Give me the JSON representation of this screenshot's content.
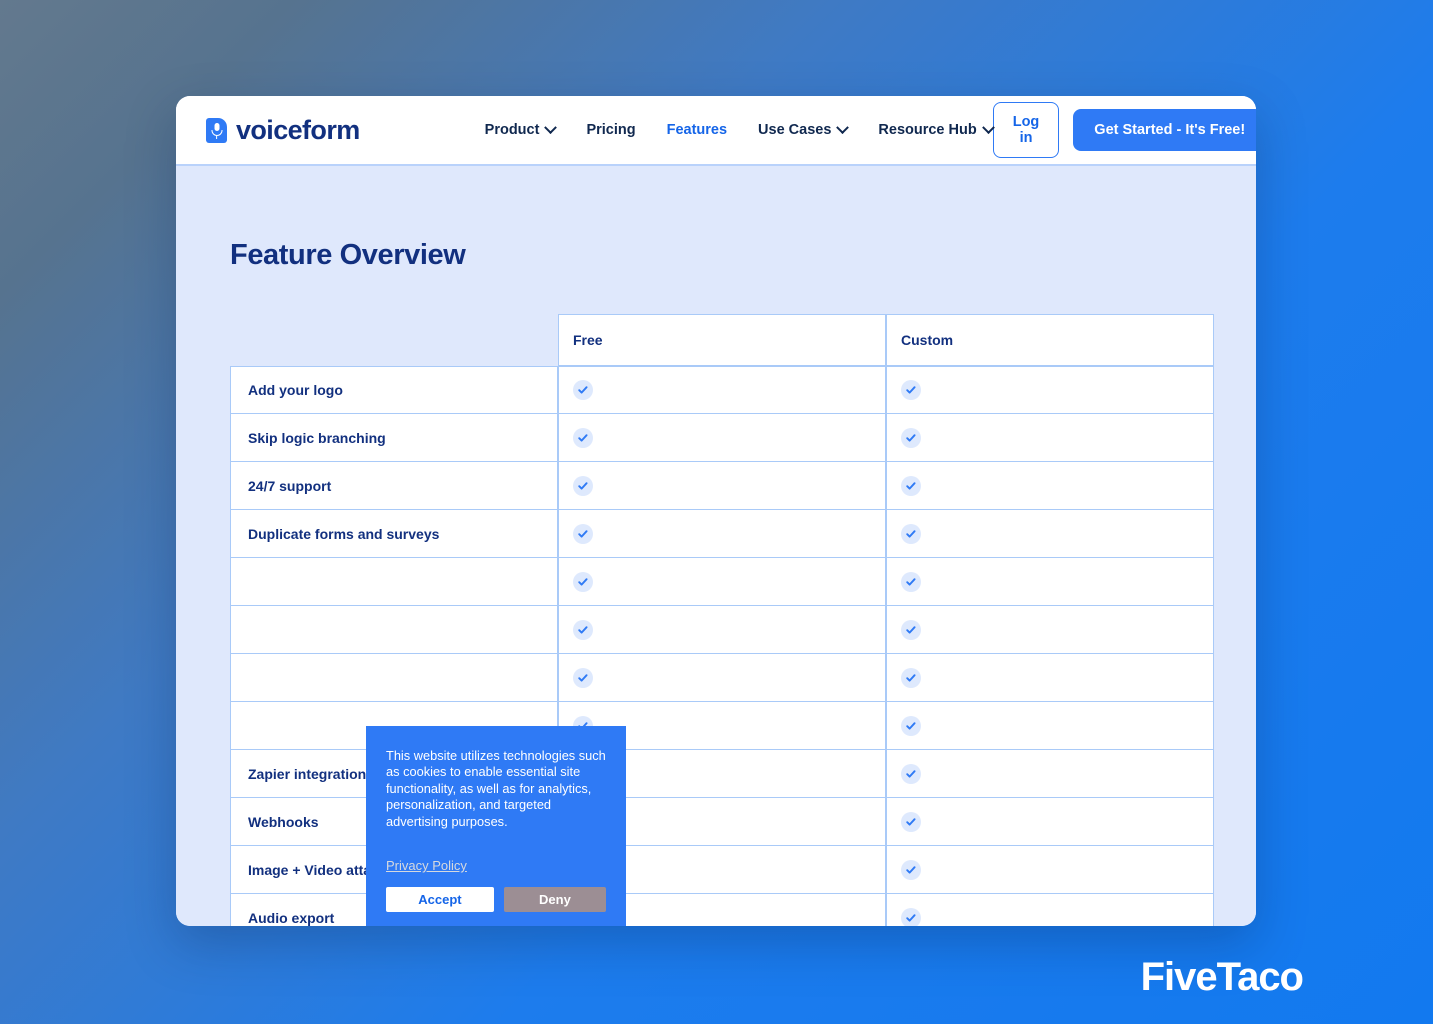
{
  "brand": {
    "logo_text": "voiceform",
    "logo_icon": "microphone-document-icon",
    "logo_color": "#2f7af5",
    "text_color": "#12307f"
  },
  "nav": {
    "links": [
      {
        "label": "Product",
        "has_dropdown": true,
        "active": false
      },
      {
        "label": "Pricing",
        "has_dropdown": false,
        "active": false
      },
      {
        "label": "Features",
        "has_dropdown": false,
        "active": true
      },
      {
        "label": "Use Cases",
        "has_dropdown": true,
        "active": false
      },
      {
        "label": "Resource Hub",
        "has_dropdown": true,
        "active": false
      }
    ],
    "login_label": "Log in",
    "cta_label": "Get Started - It's Free!"
  },
  "main": {
    "page_title": "Feature Overview",
    "background_color": "#dfe8fc"
  },
  "table": {
    "columns": [
      "",
      "Free",
      "Custom"
    ],
    "check_icon": "check-circle-icon",
    "dash_symbol": "–",
    "rows": [
      {
        "feature": "Add your logo",
        "free": "check",
        "custom": "check",
        "obscured": false
      },
      {
        "feature": "Skip logic branching",
        "free": "check",
        "custom": "check",
        "obscured": false
      },
      {
        "feature": "24/7 support",
        "free": "check",
        "custom": "check",
        "obscured": false
      },
      {
        "feature": "Duplicate forms and surveys",
        "free": "check",
        "custom": "check",
        "obscured": false
      },
      {
        "feature": "",
        "free": "check",
        "custom": "check",
        "obscured": true
      },
      {
        "feature": "",
        "free": "check",
        "custom": "check",
        "obscured": true
      },
      {
        "feature": "",
        "free": "check",
        "custom": "check",
        "obscured": true
      },
      {
        "feature": "",
        "free": "check",
        "custom": "check",
        "obscured": true
      },
      {
        "feature": "Zapier integrations",
        "free": "check",
        "custom": "check",
        "obscured": true
      },
      {
        "feature": "Webhooks",
        "free": "check",
        "custom": "check",
        "obscured": false
      },
      {
        "feature": "Image + Video attachment",
        "free": "check",
        "custom": "check",
        "obscured": false
      },
      {
        "feature": "Audio export",
        "free": "dash",
        "custom": "check",
        "obscured": false
      }
    ]
  },
  "cookie_banner": {
    "message": "This website utilizes technologies such as cookies to enable essential site functionality, as well as for analytics, personalization, and targeted advertising purposes.",
    "privacy_link": "Privacy Policy",
    "accept_label": "Accept",
    "deny_label": "Deny",
    "background_color": "#2f7af5",
    "deny_color": "#9c8e94"
  },
  "watermark": {
    "text": "FiveTaco"
  }
}
